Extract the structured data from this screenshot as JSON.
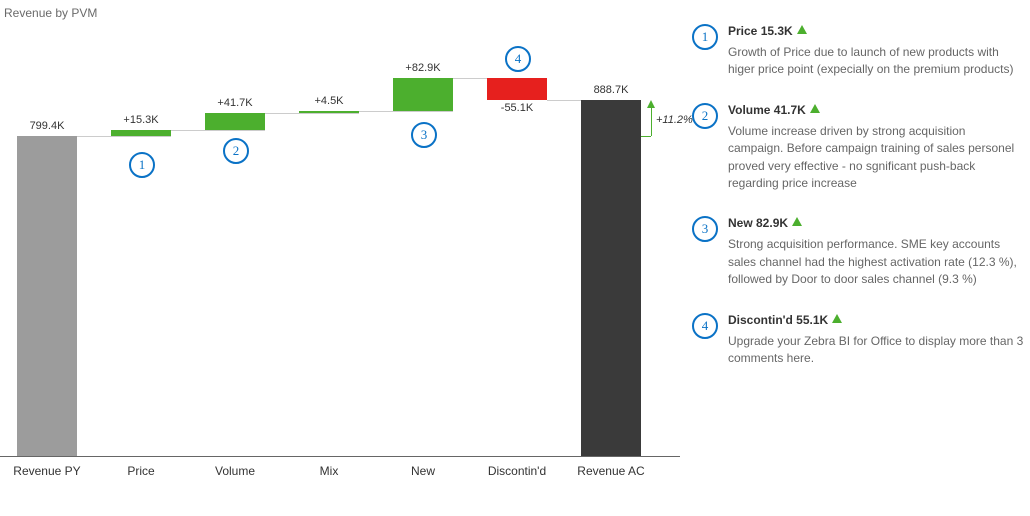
{
  "title": "Revenue by PVM",
  "pct_change": "+11.2%",
  "columns": {
    "revpy": {
      "cat": "Revenue PY",
      "label": "799.4K"
    },
    "price": {
      "cat": "Price",
      "label": "+15.3K"
    },
    "volume": {
      "cat": "Volume",
      "label": "+41.7K"
    },
    "mix": {
      "cat": "Mix",
      "label": "+4.5K"
    },
    "new": {
      "cat": "New",
      "label": "+82.9K"
    },
    "disc": {
      "cat": "Discontin'd",
      "label": "-55.1K"
    },
    "revac": {
      "cat": "Revenue AC",
      "label": "888.7K"
    }
  },
  "callouts": {
    "c1": "1",
    "c2": "2",
    "c3": "3",
    "c4": "4"
  },
  "comments": [
    {
      "num": "1",
      "head": "Price 15.3K",
      "body": "Growth of Price due to launch of new products with higer price point (expecially on the premium products)"
    },
    {
      "num": "2",
      "head": "Volume 41.7K",
      "body": "Volume increase driven by strong acquisition campaign. Before campaign training of sales personel proved very effective - no sgnificant push-back regarding price increase"
    },
    {
      "num": "3",
      "head": "New 82.9K",
      "body": "Strong acquisition performance. SME key accounts sales channel had the highest activation rate (12.3 %), followed by Door to door sales channel (9.3 %)"
    },
    {
      "num": "4",
      "head": "Discontin'd 55.1K",
      "body": "Upgrade your Zebra BI for Office to display more than 3 comments here."
    }
  ],
  "chart_data": {
    "type": "bar",
    "subtype": "waterfall",
    "title": "Revenue by PVM",
    "categories": [
      "Revenue PY",
      "Price",
      "Volume",
      "Mix",
      "New",
      "Discontin'd",
      "Revenue AC"
    ],
    "values": [
      799.4,
      15.3,
      41.7,
      4.5,
      82.9,
      -55.1,
      888.7
    ],
    "roles": [
      "start",
      "delta",
      "delta",
      "delta",
      "delta",
      "delta",
      "end"
    ],
    "unit": "K",
    "ylim": [
      0,
      950
    ],
    "pct_change": 11.2
  }
}
